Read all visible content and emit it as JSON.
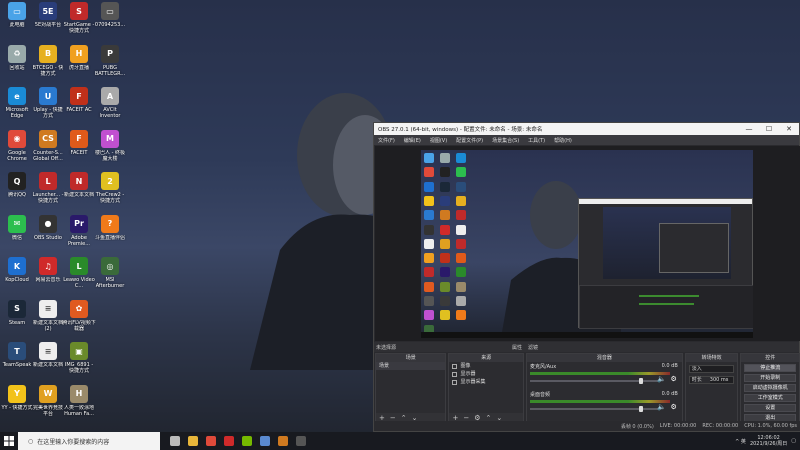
{
  "desktop": {
    "icons": [
      {
        "label": "此电脑",
        "color": "#4aa3e8",
        "glyph": "▭",
        "col": 0,
        "row": 0
      },
      {
        "label": "回收站",
        "color": "#9aa",
        "glyph": "♻",
        "col": 0,
        "row": 1
      },
      {
        "label": "Microsoft Edge",
        "color": "#1a8bd6",
        "glyph": "e",
        "col": 0,
        "row": 2
      },
      {
        "label": "Google Chrome",
        "color": "#e04a3a",
        "glyph": "◉",
        "col": 0,
        "row": 3
      },
      {
        "label": "腾讯QQ",
        "color": "#222",
        "glyph": "Q",
        "col": 0,
        "row": 4
      },
      {
        "label": "微信",
        "color": "#2cbe4e",
        "glyph": "✉",
        "col": 0,
        "row": 5
      },
      {
        "label": "KopCloud",
        "color": "#1e6fd0",
        "glyph": "K",
        "col": 0,
        "row": 6
      },
      {
        "label": "Steam",
        "color": "#1b2838",
        "glyph": "S",
        "col": 0,
        "row": 7
      },
      {
        "label": "TeamSpeak",
        "color": "#2a4d7a",
        "glyph": "T",
        "col": 0,
        "row": 8
      },
      {
        "label": "YY - 快捷方式",
        "color": "#f2c21a",
        "glyph": "Y",
        "col": 0,
        "row": 9
      },
      {
        "label": "5E对战平台",
        "color": "#2a3d7a",
        "glyph": "5E",
        "col": 1,
        "row": 0
      },
      {
        "label": "BTCEGO - 快捷方式",
        "color": "#e6b020",
        "glyph": "B",
        "col": 1,
        "row": 1
      },
      {
        "label": "Uplay - 快捷方式",
        "color": "#2a7ad0",
        "glyph": "U",
        "col": 1,
        "row": 2
      },
      {
        "label": "Counter-S... Global Off...",
        "color": "#d07a20",
        "glyph": "CS",
        "col": 1,
        "row": 3
      },
      {
        "label": "Launcher... - 快捷方式",
        "color": "#c02a2a",
        "glyph": "L",
        "col": 1,
        "row": 4
      },
      {
        "label": "OBS Studio",
        "color": "#333",
        "glyph": "●",
        "col": 1,
        "row": 5
      },
      {
        "label": "网易云音乐",
        "color": "#d02a2a",
        "glyph": "♫",
        "col": 1,
        "row": 6
      },
      {
        "label": "新建文本文档 (2)",
        "color": "#eee",
        "glyph": "≡",
        "col": 1,
        "row": 7
      },
      {
        "label": "新建文本文档",
        "color": "#eee",
        "glyph": "≡",
        "col": 1,
        "row": 8
      },
      {
        "label": "完美世界竞技平台",
        "color": "#e0a020",
        "glyph": "W",
        "col": 1,
        "row": 9
      },
      {
        "label": "StartGame - 快捷方式",
        "color": "#c02a2a",
        "glyph": "S",
        "col": 2,
        "row": 0
      },
      {
        "label": "虎牙直播",
        "color": "#f0a020",
        "glyph": "H",
        "col": 2,
        "row": 1
      },
      {
        "label": "FACEIT AC",
        "color": "#c0301a",
        "glyph": "F",
        "col": 2,
        "row": 2
      },
      {
        "label": "FACEIT",
        "color": "#e05a1a",
        "glyph": "F",
        "col": 2,
        "row": 3
      },
      {
        "label": "新建文本文档",
        "color": "#c02a2a",
        "glyph": "N",
        "col": 2,
        "row": 4
      },
      {
        "label": "Adobe Premie...",
        "color": "#2a1a6a",
        "glyph": "Pr",
        "col": 2,
        "row": 5
      },
      {
        "label": "Leawo Video C...",
        "color": "#2a8a2a",
        "glyph": "L",
        "col": 2,
        "row": 6
      },
      {
        "label": "腾讯FLV视频下载器",
        "color": "#e05a20",
        "glyph": "✿",
        "col": 2,
        "row": 7
      },
      {
        "label": "IMG_6891 - 快捷方式",
        "color": "#6a8a2a",
        "glyph": "▣",
        "col": 2,
        "row": 8
      },
      {
        "label": "人类一败涂地 Human Fa...",
        "color": "#9a8a6a",
        "glyph": "H",
        "col": 2,
        "row": 9
      },
      {
        "label": "07094253...",
        "color": "#555",
        "glyph": "▭",
        "col": 3,
        "row": 0
      },
      {
        "label": "PUBG BATTLEGR...",
        "color": "#3a3a3a",
        "glyph": "P",
        "col": 3,
        "row": 1
      },
      {
        "label": "AVCIt Inventor",
        "color": "#aaa",
        "glyph": "A",
        "col": 3,
        "row": 2
      },
      {
        "label": "楼巴人 - 终极魔大楼",
        "color": "#c050d0",
        "glyph": "M",
        "col": 3,
        "row": 3
      },
      {
        "label": "TheCrew2 - 快捷方式",
        "color": "#e0c020",
        "glyph": "2",
        "col": 3,
        "row": 4
      },
      {
        "label": "斗鱼直播伴侣",
        "color": "#f07a1a",
        "glyph": "?",
        "col": 3,
        "row": 5
      },
      {
        "label": "MSI Afterburner",
        "color": "#3a6a3a",
        "glyph": "◎",
        "col": 3,
        "row": 6
      }
    ]
  },
  "taskbar": {
    "search_placeholder": "在这里输入你要搜索的内容",
    "search_text": "在这里输入你要搜索的内容",
    "pinned": [
      {
        "name": "task-view-icon",
        "color": "#bbb"
      },
      {
        "name": "file-explorer-icon",
        "color": "#e8b63a"
      },
      {
        "name": "chrome-icon",
        "color": "#e04a3a"
      },
      {
        "name": "netease-music-icon",
        "color": "#d02a2a"
      },
      {
        "name": "nvidia-icon",
        "color": "#76b900"
      },
      {
        "name": "app-icon",
        "color": "#5a8ad0"
      },
      {
        "name": "counter-strike-icon",
        "color": "#d07a20"
      },
      {
        "name": "obs-icon",
        "color": "#555"
      }
    ],
    "time": "12:06:02",
    "date": "2021/9/26/周日",
    "tray_text": "^ 英"
  },
  "obs": {
    "title": "OBS 27.0.1 (64-bit, windows) - 配置文件: 未命名 - 场景: 未命名",
    "menu": [
      "文件(F)",
      "编辑(E)",
      "视图(V)",
      "配置文件(P)",
      "场景集合(S)",
      "工具(T)",
      "帮助(H)"
    ],
    "status_row": {
      "source_label": "未选择源",
      "props": "属性",
      "filters": "滤镜"
    },
    "docks": {
      "scenes": {
        "title": "场景",
        "items": [
          "场景"
        ]
      },
      "sources": {
        "title": "来源",
        "items": [
          "图像",
          "显示器",
          "显示器采集"
        ]
      },
      "mixer": {
        "title": "混音器",
        "tracks": [
          {
            "name": "麦克风/Aux",
            "db": "0.0 dB",
            "level": 0.7,
            "volume": 0.83
          },
          {
            "name": "桌面音频",
            "db": "0.0 dB",
            "level": 0.75,
            "volume": 0.83
          }
        ]
      },
      "transitions": {
        "title": "转场特效",
        "type_label": "淡入",
        "duration_label": "时长",
        "duration_value": "300 ms"
      },
      "controls": {
        "title": "控件",
        "buttons": [
          "停止推流",
          "开始录制",
          "启动虚拟摄像机",
          "工作室模式",
          "设置",
          "退出"
        ]
      }
    },
    "statusbar": {
      "live": "LIVE: 00:00:00",
      "rec": "REC: 00:00:00",
      "cpu": "CPU: 1.0%, 60.00 fps",
      "drop": "丢帧 0 (0.0%)"
    },
    "window_controls": [
      "—",
      "☐",
      "✕"
    ]
  }
}
